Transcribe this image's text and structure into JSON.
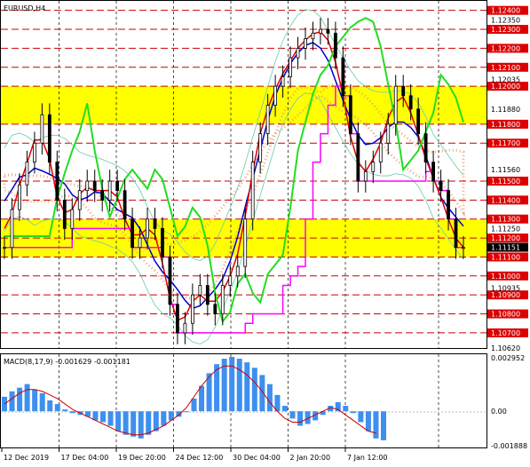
{
  "window": {
    "symbol_label": "EURUSD,H4"
  },
  "indicator": {
    "label": "MACD(8,17,9) -0.001629 -0.001181"
  },
  "colors": {
    "background": "#ffffff",
    "zone": "#ffff00",
    "level_line": "#cc0000",
    "level_label_bg": "#dd0000",
    "candle": "#000000",
    "blue_line": "#0000cc",
    "red_line": "#dd0000",
    "green_line": "#22dd22",
    "magenta_line": "#ff00ff",
    "cloud": "#e8a070",
    "env_line": "#66ccaa",
    "hist": "#3d8ff0",
    "signal": "#cc0000",
    "price_box": "#000000"
  },
  "chart_data": [
    {
      "type": "candlestick",
      "title": "EURUSD,H4",
      "ylim": [
        1.1062,
        1.1245
      ],
      "y_ticks": [
        "1.12350",
        "1.12035",
        "1.11880",
        "1.11560",
        "1.11250",
        "1.11151",
        "1.10935",
        "1.10620"
      ],
      "levels": [
        "1.12400",
        "1.12300",
        "1.12200",
        "1.12100",
        "1.12000",
        "1.11800",
        "1.11700",
        "1.11500",
        "1.11400",
        "1.11300",
        "1.11200",
        "1.11100",
        "1.11000",
        "1.10900",
        "1.10800",
        "1.10700"
      ],
      "current_price": "1.11151",
      "zones": [
        {
          "from": 1.118,
          "to": 1.12
        },
        {
          "from": 1.111,
          "to": 1.113
        }
      ],
      "x_labels": [
        "12 Dec 2019",
        "17 Dec 04:00",
        "19 Dec 20:00",
        "24 Dec 12:00",
        "30 Dec 04:00",
        "2 Jan 20:00",
        "7 Jan 12:00"
      ],
      "series": [
        {
          "values": [
            1.1115,
            1.1135,
            1.1148,
            1.116,
            1.117,
            1.1185,
            1.116,
            1.114,
            1.1125,
            1.1135,
            1.1145,
            1.115,
            1.1145,
            1.114,
            1.115,
            1.1145,
            1.113,
            1.1115,
            1.112,
            1.113,
            1.1125,
            1.111,
            1.1085,
            1.107,
            1.1075,
            1.109,
            1.1095,
            1.1085,
            1.108,
            1.1095,
            1.11,
            1.1105,
            1.113,
            1.116,
            1.1175,
            1.119,
            1.12,
            1.1205,
            1.1215,
            1.122,
            1.1225,
            1.1228,
            1.123,
            1.1228,
            1.1215,
            1.1195,
            1.1175,
            1.115,
            1.1155,
            1.116,
            1.117,
            1.118,
            1.12,
            1.1195,
            1.1188,
            1.1175,
            1.116,
            1.115,
            1.1145,
            1.113,
            1.1115,
            1.1115
          ]
        }
      ]
    },
    {
      "type": "bar",
      "title": "MACD(8,17,9)",
      "values_labels": [
        "-0.001629",
        "-0.001181"
      ],
      "ylim": [
        -0.0019,
        0.003
      ],
      "y_ticks": [
        "0.002952",
        "0.00",
        "-0.001888"
      ],
      "values": [
        0.0008,
        0.0011,
        0.0013,
        0.0015,
        0.0012,
        0.001,
        0.0006,
        0.0004,
        0.0001,
        -0.0001,
        -0.0002,
        -0.0003,
        -0.0005,
        -0.0006,
        -0.0008,
        -0.0011,
        -0.0013,
        -0.0014,
        -0.0015,
        -0.0013,
        -0.0011,
        -0.0008,
        -0.0005,
        -0.0003,
        0.0,
        0.0007,
        0.0014,
        0.0021,
        0.0026,
        0.0029,
        0.003,
        0.0029,
        0.0027,
        0.0024,
        0.002,
        0.0015,
        0.0009,
        0.0003,
        -0.0004,
        -0.0008,
        -0.0007,
        -0.0005,
        -0.0002,
        0.0003,
        0.0005,
        0.0003,
        -0.0001,
        -0.0006,
        -0.0011,
        -0.0015,
        -0.0016
      ],
      "series": [
        {
          "values": [
            0.0004,
            0.0007,
            0.001,
            0.0012,
            0.0012,
            0.0011,
            0.0009,
            0.0007,
            0.0004,
            0.0001,
            -0.0001,
            -0.0003,
            -0.0005,
            -0.0007,
            -0.0009,
            -0.0011,
            -0.0012,
            -0.0013,
            -0.0013,
            -0.0012,
            -0.001,
            -0.0008,
            -0.0005,
            -0.0002,
            0.0002,
            0.0008,
            0.0014,
            0.0019,
            0.0023,
            0.0025,
            0.0025,
            0.0023,
            0.002,
            0.0016,
            0.0011,
            0.0005,
            0.0,
            -0.0004,
            -0.0006,
            -0.0006,
            -0.0004,
            -0.0002,
            0.0,
            0.0002,
            0.0001,
            -0.0002,
            -0.0005,
            -0.0008,
            -0.0011,
            -0.0012
          ]
        }
      ]
    }
  ]
}
